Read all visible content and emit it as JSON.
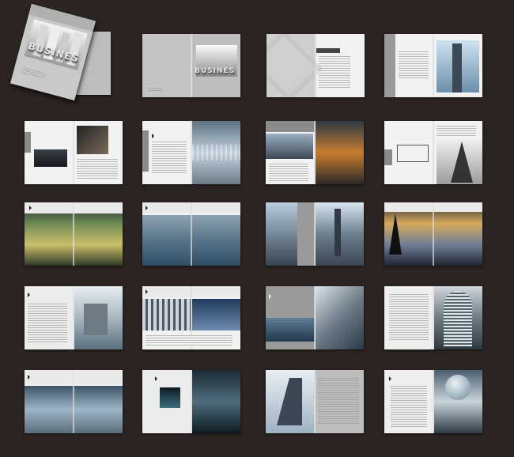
{
  "cover": {
    "brand_word": "BUSINES",
    "brand_word_2": "BUSINES"
  },
  "pages": {
    "r1c2_heading": "",
    "r1c3_heading": "",
    "r1c4_heading": "",
    "r2c1_heading": "",
    "r2c2_heading": "",
    "r2c3_heading": "",
    "r2c4_heading": "",
    "r3c1_heading": "",
    "r3c2_heading": "",
    "r3c3_heading": "",
    "r3c4_heading": "",
    "r4c1_heading": "",
    "r4c2_heading": "",
    "r4c3_heading": "",
    "r4c4_heading": "",
    "r5c1_heading": "",
    "r5c2_heading": "",
    "r5c3_heading": "",
    "r5c4_heading": ""
  },
  "colors": {
    "background": "#2b2422",
    "page": "#f2f2f2",
    "accent_gray": "#8a8a8a",
    "dark_photo": "#1e2a33"
  }
}
